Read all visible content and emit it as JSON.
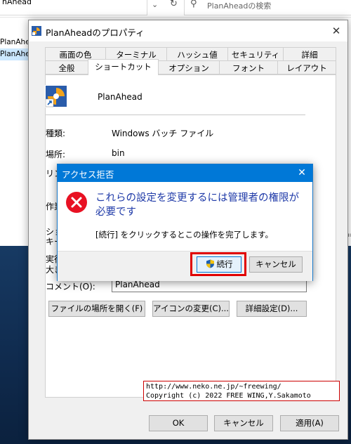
{
  "explorer": {
    "address_text": "nAhead",
    "search_placeholder": "PlanAheadの検索",
    "left_items": [
      "PlanAhead",
      "PlanAhead"
    ]
  },
  "properties_window": {
    "title": "PlanAheadのプロパティ",
    "tabs_row1": [
      "画面の色",
      "ターミナル",
      "ハッシュ値",
      "セキュリティ",
      "詳細"
    ],
    "tabs_row2": [
      "全般",
      "ショートカット",
      "オプション",
      "フォント",
      "レイアウト"
    ],
    "active_tab": "ショートカット",
    "app_name": "PlanAhead",
    "fields": {
      "type_label": "種類:",
      "type_value": "Windows バッチ ファイル",
      "location_label": "場所:",
      "location_value": "bin",
      "link_label_partial": "リン",
      "workdir_label_partial": "作業",
      "shortcut_label_partial_1": "ショ",
      "shortcut_label_partial_2": "キー",
      "run_label_partial_1": "実行",
      "run_label_partial_2": "大き",
      "comment_label": "コメント(O):",
      "comment_value": "PlanAhead"
    },
    "buttons": {
      "open_location": "ファイルの場所を開く(F)",
      "change_icon": "アイコンの変更(C)...",
      "advanced": "詳細設定(D)..."
    },
    "footer_buttons": {
      "ok": "OK",
      "cancel": "キャンセル",
      "apply": "適用(A)"
    }
  },
  "watermark": {
    "line1": "http://www.neko.ne.jp/~freewing/",
    "line2": "Copyright (c) 2022 FREE WING,Y.Sakamoto"
  },
  "uac_dialog": {
    "title": "アクセス拒否",
    "message": "これらの設定を変更するには管理者の権限が必要です",
    "sub_message": "[続行] をクリックするとこの操作を完了します。",
    "continue_label": "続行",
    "cancel_label": "キャンセル"
  },
  "colors": {
    "uac_title_bar": "#0078d7",
    "uac_message_text": "#1f3aa8",
    "highlight_frame": "#e00000",
    "error_icon": "#e81123"
  }
}
